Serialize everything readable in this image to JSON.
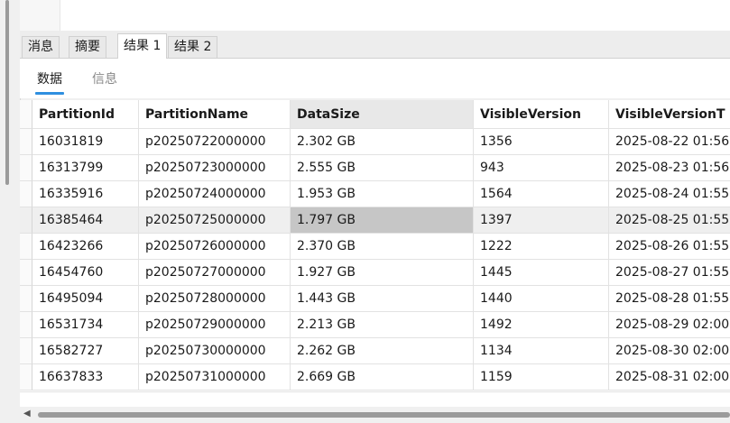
{
  "result_tabs": [
    "消息",
    "摘要",
    "结果 1",
    "结果 2"
  ],
  "active_result_tab": "结果 1",
  "sub_tabs": [
    "数据",
    "信息"
  ],
  "active_sub_tab": "数据",
  "columns": [
    "PartitionId",
    "PartitionName",
    "DataSize",
    "VisibleVersion",
    "VisibleVersionT"
  ],
  "sorted_column": "DataSize",
  "rows": [
    [
      "16031819",
      "p20250722000000",
      "2.302 GB",
      "1356",
      "2025-08-22 01:56"
    ],
    [
      "16313799",
      "p20250723000000",
      "2.555 GB",
      "943",
      "2025-08-23 01:56"
    ],
    [
      "16335916",
      "p20250724000000",
      "1.953 GB",
      "1564",
      "2025-08-24 01:55"
    ],
    [
      "16385464",
      "p20250725000000",
      "1.797 GB",
      "1397",
      "2025-08-25 01:55"
    ],
    [
      "16423266",
      "p20250726000000",
      "2.370 GB",
      "1222",
      "2025-08-26 01:55"
    ],
    [
      "16454760",
      "p20250727000000",
      "1.927 GB",
      "1445",
      "2025-08-27 01:55"
    ],
    [
      "16495094",
      "p20250728000000",
      "1.443 GB",
      "1440",
      "2025-08-28 01:55"
    ],
    [
      "16531734",
      "p20250729000000",
      "2.213 GB",
      "1492",
      "2025-08-29 02:00"
    ],
    [
      "16582727",
      "p20250730000000",
      "2.262 GB",
      "1134",
      "2025-08-30 02:00"
    ],
    [
      "16637833",
      "p20250731000000",
      "2.669 GB",
      "1159",
      "2025-08-31 02:00"
    ]
  ],
  "selected_row": 3,
  "selected_column": 2,
  "scroll_left_icon": "triangle-left-icon"
}
